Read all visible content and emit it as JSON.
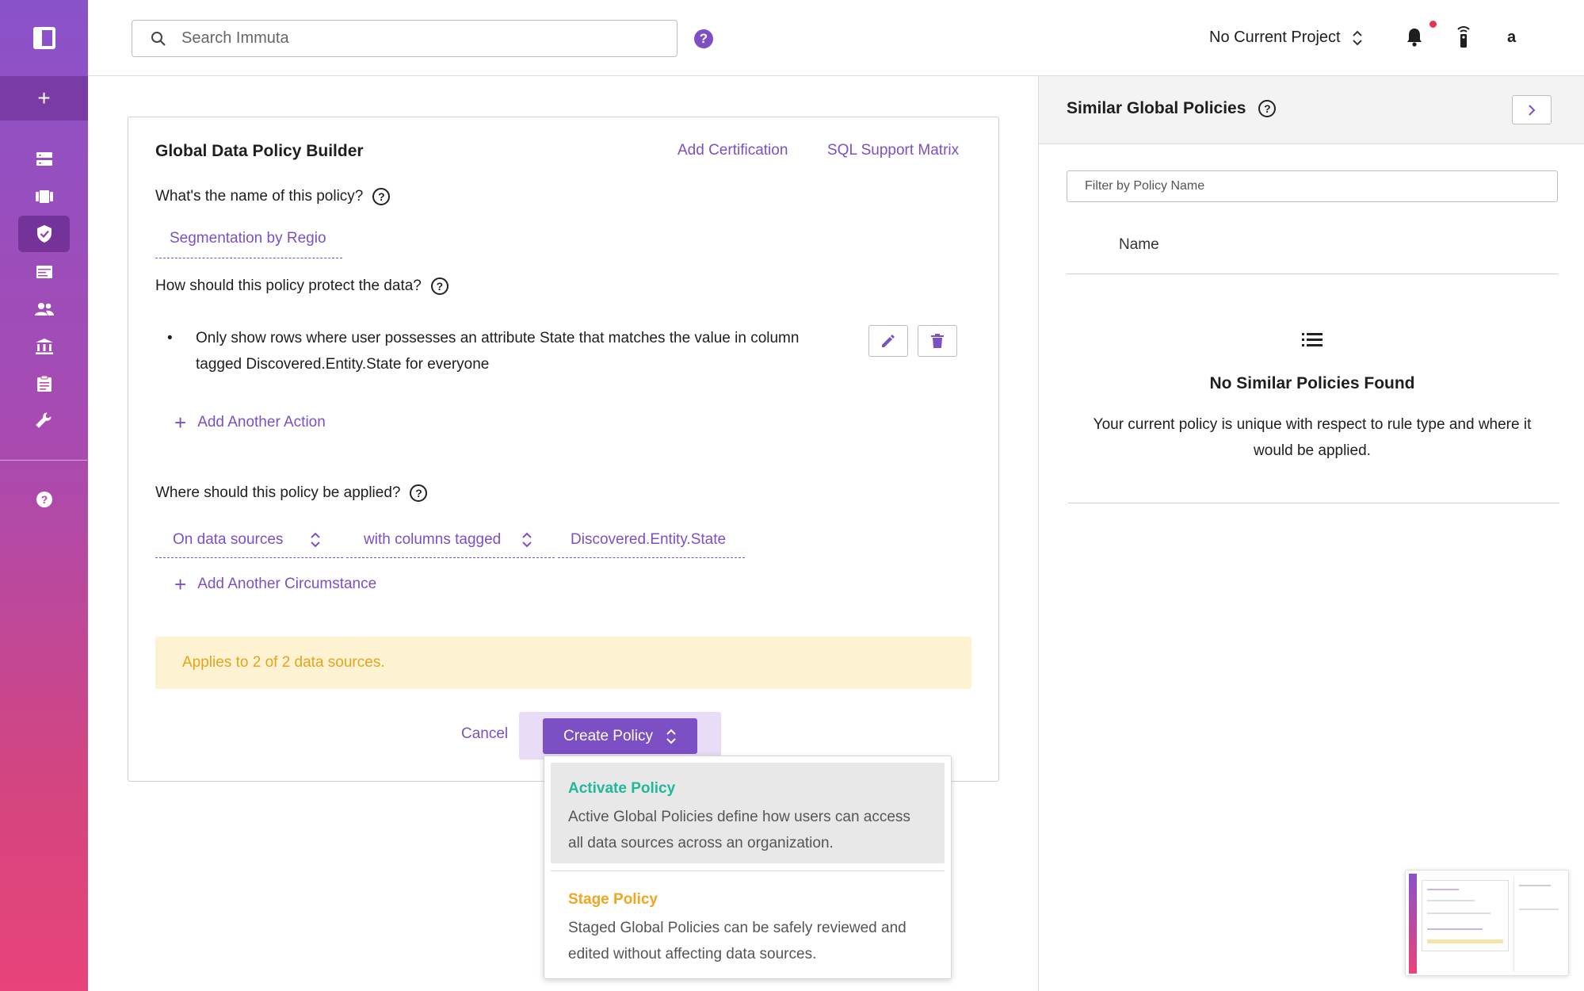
{
  "topbar": {
    "search_placeholder": "Search Immuta",
    "project_label": "No Current Project",
    "user_initial": "a"
  },
  "sidebar": {
    "items": [
      "data-sources-icon",
      "projects-icon",
      "policies-icon",
      "queries-icon",
      "people-icon",
      "governance-icon",
      "audit-icon",
      "settings-icon",
      "help-icon"
    ],
    "active_item": "policies-icon"
  },
  "builder": {
    "title": "Global Data Policy Builder",
    "add_certification": "Add Certification",
    "sql_support_matrix": "SQL Support Matrix",
    "q_name": "What's the name of this policy?",
    "policy_name": "Segmentation by Regio",
    "q_protect": "How should this policy protect the data?",
    "action_text": "Only show rows where user possesses an attribute State that matches the value in column tagged Discovered.Entity.State for everyone",
    "add_action": "Add Another Action",
    "q_applied": "Where should this policy be applied?",
    "circumstance": {
      "scope": "On data sources",
      "condition": "with columns tagged",
      "tag": "Discovered.Entity.State"
    },
    "add_circumstance": "Add Another Circumstance",
    "applies_text": "Applies to 2 of 2 data sources.",
    "cancel": "Cancel",
    "create_policy": "Create Policy"
  },
  "menu": {
    "activate_title": "Activate Policy",
    "activate_desc": "Active Global Policies define how users can access all data sources across an organization.",
    "stage_title": "Stage Policy",
    "stage_desc": "Staged Global Policies can be safely reviewed and edited without affecting data sources."
  },
  "right_panel": {
    "title": "Similar Global Policies",
    "filter_placeholder": "Filter by Policy Name",
    "column_name": "Name",
    "empty_title": "No Similar Policies Found",
    "empty_desc": "Your current policy is unique with respect to rule type and where it would be applied."
  },
  "colors": {
    "accent": "#7c4fc5",
    "activate": "#1fb89a",
    "stage": "#f2a51f",
    "applies_bg": "#fdf3d3",
    "applies_text": "#e8a21a"
  }
}
